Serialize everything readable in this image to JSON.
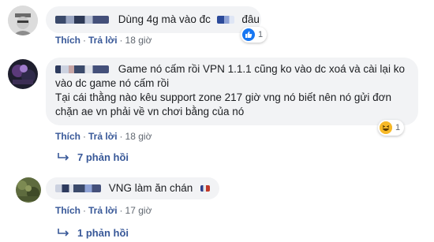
{
  "comments": [
    {
      "text": "Dùng 4g mà vào đc",
      "text_tail": "đâu",
      "actions": {
        "like": "Thích",
        "reply": "Trả lời",
        "time": "18 giờ"
      },
      "reaction": {
        "icon": "like-icon",
        "count": "1"
      }
    },
    {
      "text": "Game nó cấm rồi VPN 1.1.1 cũng ko vào dc xoá và cài lại ko vào dc game nó cấm rồi\nTại cái thằng nào kêu support zone 217 giờ vng nó biết nên nó gửi đơn chặn ae vn phải về vn chơi bằng của nó",
      "actions": {
        "like": "Thích",
        "reply": "Trả lời",
        "time": "18 giờ"
      },
      "reaction": {
        "icon": "haha-icon",
        "count": "1"
      },
      "replies": "7 phản hồi"
    },
    {
      "text": "VNG làm ăn chán",
      "actions": {
        "like": "Thích",
        "reply": "Trả lời",
        "time": "17 giờ"
      },
      "replies": "1 phản hồi"
    }
  ],
  "colors": {
    "link": "#385898",
    "bubble": "#f2f3f5",
    "like": "#1877f2",
    "haha": "#f7b928"
  }
}
